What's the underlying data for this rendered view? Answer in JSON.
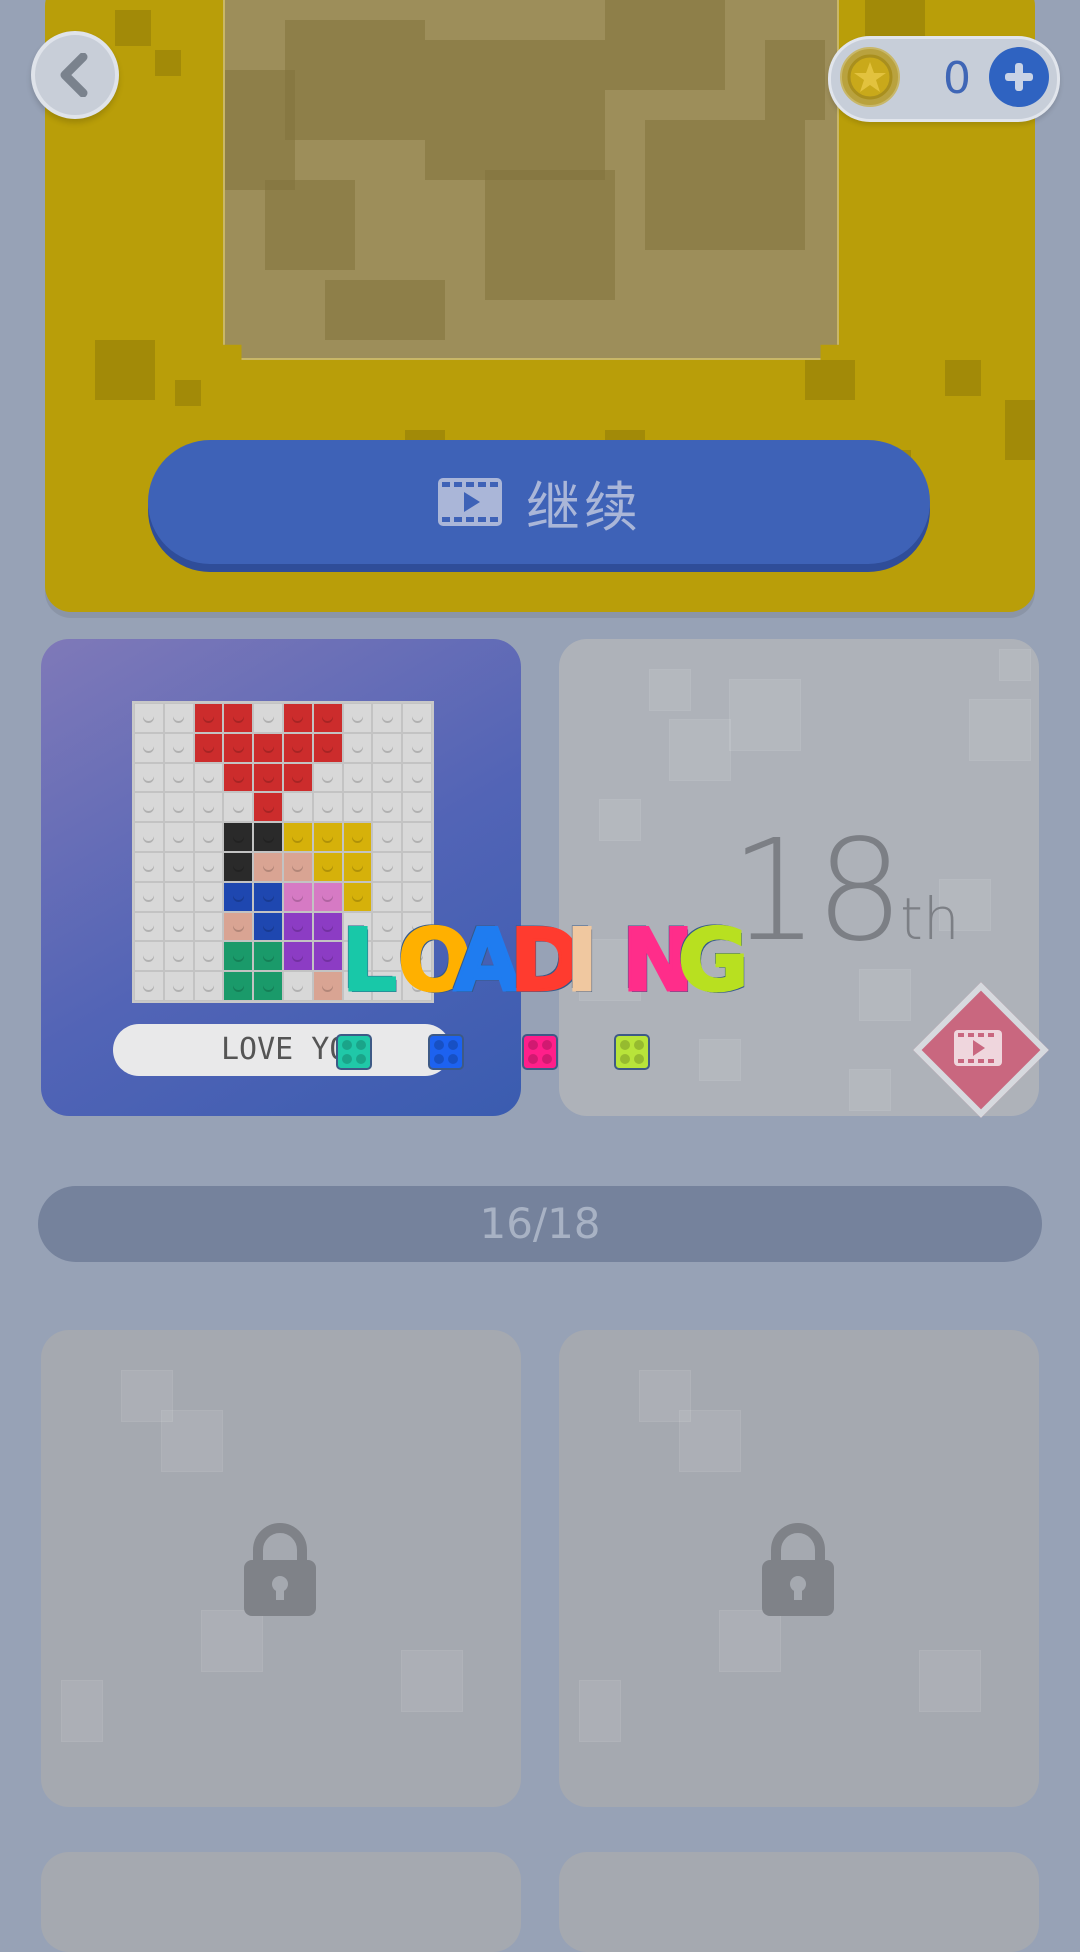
{
  "header": {
    "coins": "0"
  },
  "continue_card": {
    "button_label": "继续"
  },
  "levels": {
    "current": {
      "name": "LOVE YOU"
    },
    "next": {
      "number": "18",
      "suffix": "th"
    }
  },
  "progress": {
    "text": "16/18",
    "value": 0.889
  },
  "loading": {
    "letters": [
      "L",
      "O",
      "A",
      "D",
      "I",
      "N",
      "G"
    ],
    "letter_colors": [
      "#18c8a8",
      "#ffb000",
      "#1f7cf0",
      "#ff3b2f",
      "#f0c8a0",
      "#ff2d8a",
      "#b8e020"
    ],
    "dot_colors": [
      "#20c8a8",
      "#1d62f0",
      "#ff1f8a",
      "#b8e43a"
    ]
  },
  "puzzle_grid": {
    "rows": [
      [
        "W",
        "W",
        "R",
        "R",
        "W",
        "R",
        "R",
        "W",
        "W",
        "W"
      ],
      [
        "W",
        "W",
        "R",
        "R",
        "R",
        "R",
        "R",
        "W",
        "W",
        "W"
      ],
      [
        "W",
        "W",
        "W",
        "R",
        "R",
        "R",
        "W",
        "W",
        "W",
        "W"
      ],
      [
        "W",
        "W",
        "W",
        "W",
        "R",
        "W",
        "W",
        "W",
        "W",
        "W"
      ],
      [
        "W",
        "W",
        "W",
        "K",
        "K",
        "Y",
        "Y",
        "Y",
        "W",
        "W"
      ],
      [
        "W",
        "W",
        "W",
        "K",
        "S",
        "S",
        "Y",
        "Y",
        "W",
        "W"
      ],
      [
        "W",
        "W",
        "W",
        "B",
        "B",
        "P",
        "P",
        "Y",
        "W",
        "W"
      ],
      [
        "W",
        "W",
        "W",
        "S",
        "B",
        "V",
        "V",
        "W",
        "W",
        "W"
      ],
      [
        "W",
        "W",
        "W",
        "G",
        "G",
        "V",
        "V",
        "W",
        "W",
        "W"
      ],
      [
        "W",
        "W",
        "W",
        "G",
        "G",
        "W",
        "S",
        "W",
        "W",
        "W"
      ]
    ],
    "palette": {
      "W": "#d8d8d8",
      "R": "#cc2c2c",
      "K": "#2a2a2a",
      "Y": "#d6b10a",
      "S": "#d9a493",
      "B": "#1e47b0",
      "P": "#d67ac4",
      "V": "#8c3cc4",
      "G": "#1a9a6a"
    }
  },
  "colors": {
    "accent_blue": "#3e62b7",
    "card_yellow": "#b99e09",
    "diamond_pink": "#c9677f"
  }
}
